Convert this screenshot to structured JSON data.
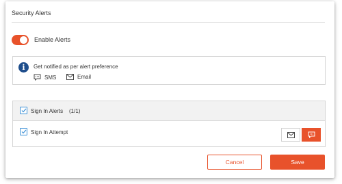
{
  "panel": {
    "title": "Security Alerts"
  },
  "toggle": {
    "label": "Enable Alerts",
    "enabled": true
  },
  "info": {
    "icon": "info-icon",
    "text": "Get notified as per alert preference",
    "channels": [
      {
        "icon": "sms-icon",
        "label": "SMS"
      },
      {
        "icon": "email-icon",
        "label": "Email"
      }
    ]
  },
  "alerts": {
    "group": {
      "label": "Sign In Alerts",
      "count": "(1/1)",
      "checked": true
    },
    "items": [
      {
        "label": "Sign In Attempt",
        "checked": true,
        "email_selected": false,
        "sms_selected": true
      }
    ]
  },
  "actions": {
    "cancel_label": "Cancel",
    "save_label": "Save"
  },
  "colors": {
    "accent": "#e8522b",
    "info": "#1f4e8c",
    "checkbox": "#3a8fd6"
  }
}
